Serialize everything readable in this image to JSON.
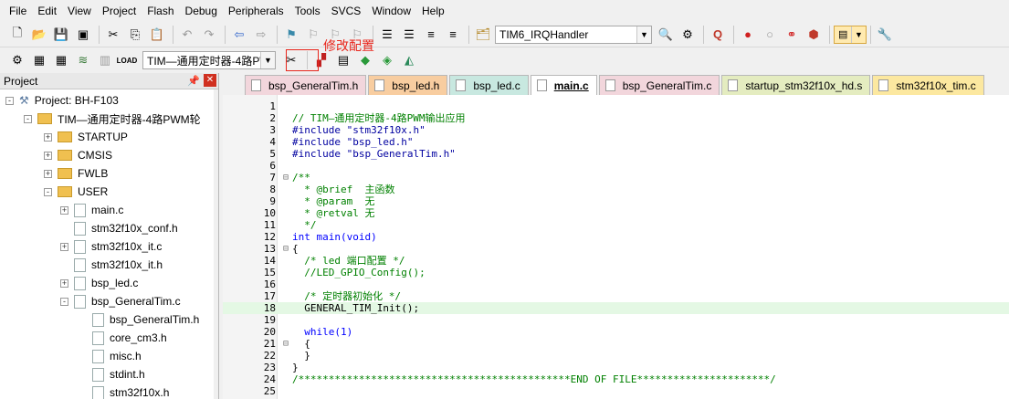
{
  "menu": [
    "File",
    "Edit",
    "View",
    "Project",
    "Flash",
    "Debug",
    "Peripherals",
    "Tools",
    "SVCS",
    "Window",
    "Help"
  ],
  "toolbar": {
    "function_combo": "TIM6_IRQHandler",
    "target_combo": "TIM—通用定时器-4路P\\",
    "annotation": "修改配置",
    "colors": {
      "accent_red": "#e8261c",
      "tab_active": "#ffffff"
    }
  },
  "project_panel": {
    "title": "Project",
    "tree": [
      {
        "label": "Project: BH-F103",
        "level": 0,
        "kind": "project",
        "expander": "-"
      },
      {
        "label": "TIM—通用定时器-4路PWM轮",
        "level": 1,
        "kind": "target",
        "expander": "-"
      },
      {
        "label": "STARTUP",
        "level": 2,
        "kind": "folder",
        "expander": "+"
      },
      {
        "label": "CMSIS",
        "level": 2,
        "kind": "folder",
        "expander": "+"
      },
      {
        "label": "FWLB",
        "level": 2,
        "kind": "folder",
        "expander": "+"
      },
      {
        "label": "USER",
        "level": 2,
        "kind": "folder",
        "expander": "-"
      },
      {
        "label": "main.c",
        "level": 3,
        "kind": "file",
        "expander": "+"
      },
      {
        "label": "stm32f10x_conf.h",
        "level": 3,
        "kind": "file",
        "expander": ""
      },
      {
        "label": "stm32f10x_it.c",
        "level": 3,
        "kind": "file",
        "expander": "+"
      },
      {
        "label": "stm32f10x_it.h",
        "level": 3,
        "kind": "file",
        "expander": ""
      },
      {
        "label": "bsp_led.c",
        "level": 3,
        "kind": "file",
        "expander": "+"
      },
      {
        "label": "bsp_GeneralTim.c",
        "level": 3,
        "kind": "file",
        "expander": "-"
      },
      {
        "label": "bsp_GeneralTim.h",
        "level": 4,
        "kind": "file",
        "expander": ""
      },
      {
        "label": "core_cm3.h",
        "level": 4,
        "kind": "file",
        "expander": ""
      },
      {
        "label": "misc.h",
        "level": 4,
        "kind": "file",
        "expander": ""
      },
      {
        "label": "stdint.h",
        "level": 4,
        "kind": "file",
        "expander": ""
      },
      {
        "label": "stm32f10x.h",
        "level": 4,
        "kind": "file",
        "expander": ""
      }
    ]
  },
  "tabs": [
    {
      "label": "bsp_GeneralTim.h",
      "color": "#f2d6dc",
      "active": false
    },
    {
      "label": "bsp_led.h",
      "color": "#f8cda0",
      "active": false
    },
    {
      "label": "bsp_led.c",
      "color": "#c8e8e0",
      "active": false
    },
    {
      "label": "main.c",
      "color": "#ffffff",
      "active": true
    },
    {
      "label": "bsp_GeneralTim.c",
      "color": "#f2d6dc",
      "active": false
    },
    {
      "label": "startup_stm32f10x_hd.s",
      "color": "#e4ecc0",
      "active": false
    },
    {
      "label": "stm32f10x_tim.c",
      "color": "#fce8a0",
      "active": false
    }
  ],
  "code_lines": [
    {
      "n": "1",
      "fold": "",
      "text": "",
      "cls": "c-tx"
    },
    {
      "n": "2",
      "fold": "",
      "text": "// TIM—通用定时器-4路PWM输出应用",
      "cls": "c-com"
    },
    {
      "n": "3",
      "fold": "",
      "text": "#include \"stm32f10x.h\"",
      "cls": "c-pp"
    },
    {
      "n": "4",
      "fold": "",
      "text": "#include \"bsp_led.h\"",
      "cls": "c-pp"
    },
    {
      "n": "5",
      "fold": "",
      "text": "#include \"bsp_GeneralTim.h\"",
      "cls": "c-pp"
    },
    {
      "n": "6",
      "fold": "",
      "text": "",
      "cls": "c-tx"
    },
    {
      "n": "7",
      "fold": "⊟",
      "text": "/**",
      "cls": "c-com"
    },
    {
      "n": "8",
      "fold": "",
      "text": "  * @brief  主函数",
      "cls": "c-com"
    },
    {
      "n": "9",
      "fold": "",
      "text": "  * @param  无",
      "cls": "c-com"
    },
    {
      "n": "10",
      "fold": "",
      "text": "  * @retval 无",
      "cls": "c-com"
    },
    {
      "n": "11",
      "fold": "",
      "text": "  */",
      "cls": "c-com"
    },
    {
      "n": "12",
      "fold": "",
      "text": "int main(void)",
      "cls": "c-kw"
    },
    {
      "n": "13",
      "fold": "⊟",
      "text": "{",
      "cls": "c-tx"
    },
    {
      "n": "14",
      "fold": "",
      "text": "  /* led 端口配置 */",
      "cls": "c-com"
    },
    {
      "n": "15",
      "fold": "",
      "text": "  //LED_GPIO_Config();",
      "cls": "c-com"
    },
    {
      "n": "16",
      "fold": "",
      "text": "",
      "cls": "c-tx"
    },
    {
      "n": "17",
      "fold": "",
      "text": "  /* 定时器初始化 */",
      "cls": "c-com"
    },
    {
      "n": "18",
      "fold": "",
      "text": "  GENERAL_TIM_Init();",
      "cls": "c-tx",
      "highlight": true
    },
    {
      "n": "19",
      "fold": "",
      "text": "",
      "cls": "c-tx"
    },
    {
      "n": "20",
      "fold": "",
      "text": "  while(1)",
      "cls": "c-kw"
    },
    {
      "n": "21",
      "fold": "⊟",
      "text": "  {",
      "cls": "c-tx"
    },
    {
      "n": "22",
      "fold": "",
      "text": "  }",
      "cls": "c-tx"
    },
    {
      "n": "23",
      "fold": "",
      "text": "}",
      "cls": "c-tx"
    },
    {
      "n": "24",
      "fold": "",
      "text": "/*********************************************END OF FILE**********************/",
      "cls": "c-com"
    },
    {
      "n": "25",
      "fold": "",
      "text": "",
      "cls": "c-tx"
    }
  ]
}
